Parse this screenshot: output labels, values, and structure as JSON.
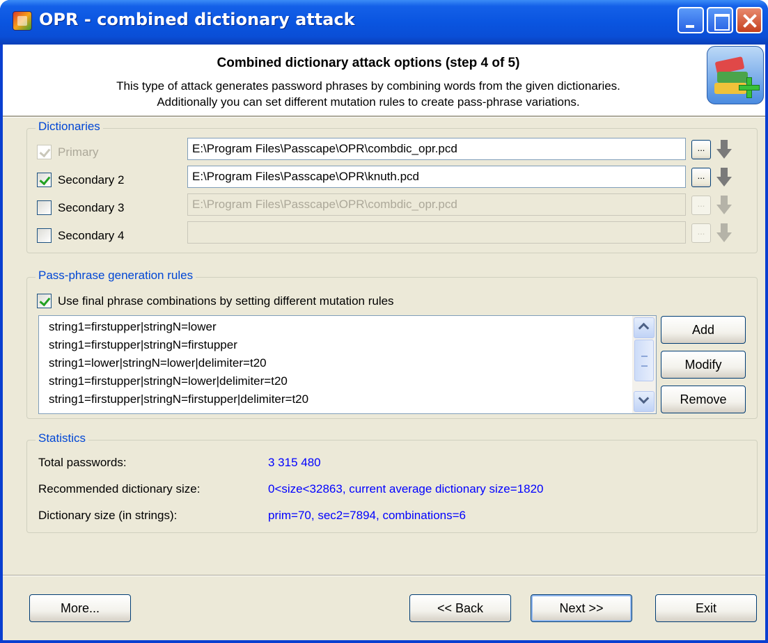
{
  "window": {
    "title": "OPR - combined dictionary attack"
  },
  "header": {
    "title": "Combined dictionary attack options (step 4 of 5)",
    "description_line1": "This type of attack generates password phrases by combining words from the given dictionaries.",
    "description_line2": "Additionally you can set different mutation rules to create pass-phrase variations."
  },
  "dictionaries": {
    "legend": "Dictionaries",
    "rows": [
      {
        "label": "Primary",
        "checked": true,
        "enabled": false,
        "path": "E:\\Program Files\\Passcape\\OPR\\combdic_opr.pcd",
        "path_enabled": true
      },
      {
        "label": "Secondary 2",
        "checked": true,
        "enabled": true,
        "path": "E:\\Program Files\\Passcape\\OPR\\knuth.pcd",
        "path_enabled": true
      },
      {
        "label": "Secondary 3",
        "checked": false,
        "enabled": true,
        "path": "E:\\Program Files\\Passcape\\OPR\\combdic_opr.pcd",
        "path_enabled": false
      },
      {
        "label": "Secondary 4",
        "checked": false,
        "enabled": true,
        "path": "",
        "path_enabled": false
      }
    ],
    "browse_label": "..."
  },
  "rules": {
    "legend": "Pass-phrase generation rules",
    "use_rules_label": "Use final phrase combinations by setting different mutation rules",
    "use_rules_checked": true,
    "items": [
      "string1=firstupper|stringN=lower",
      "string1=firstupper|stringN=firstupper",
      "string1=lower|stringN=lower|delimiter=t20",
      "string1=firstupper|stringN=lower|delimiter=t20",
      "string1=firstupper|stringN=firstupper|delimiter=t20"
    ],
    "add_label": "Add",
    "modify_label": "Modify",
    "remove_label": "Remove"
  },
  "statistics": {
    "legend": "Statistics",
    "total_label": "Total passwords:",
    "total_value": "3 315 480",
    "recommended_label": "Recommended dictionary size:",
    "recommended_value": "0<size<32863,  current average dictionary size=1820",
    "size_label": "Dictionary size (in strings):",
    "size_value": "prim=70, sec2=7894, combinations=6"
  },
  "footer": {
    "more_label": "More...",
    "back_label": "<< Back",
    "next_label": "Next >>",
    "exit_label": "Exit"
  },
  "colors": {
    "titlebar": "#0a55e0",
    "face": "#ece9d8",
    "legend": "#0046d5",
    "stat_value": "#0000ff"
  }
}
